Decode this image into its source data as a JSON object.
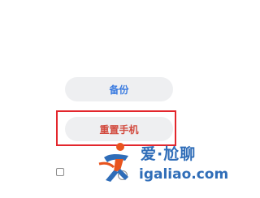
{
  "buttons": {
    "backup_label": "备份",
    "reset_label": "重置手机"
  },
  "watermark": {
    "title": "爱·尬聊",
    "url": "igaliao.com"
  },
  "colors": {
    "button_bg": "#eeeff1",
    "backup_text": "#3a7be0",
    "reset_text": "#d24a3e",
    "highlight": "#e3262c",
    "watermark": "#2f6db8",
    "watermark_accent": "#e8541e"
  },
  "nav_bar": {
    "icons": [
      "recent-apps-icon",
      "home-icon"
    ]
  }
}
